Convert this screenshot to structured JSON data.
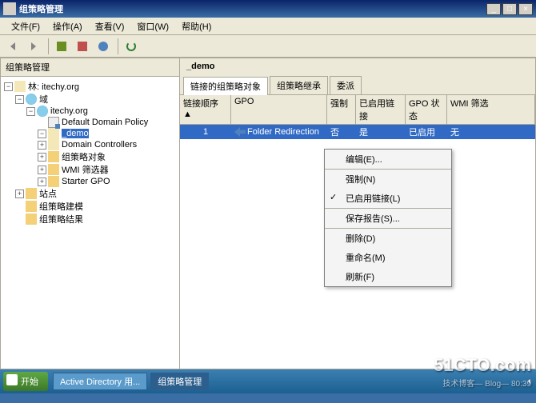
{
  "window": {
    "title": "组策略管理"
  },
  "menu": [
    "文件(F)",
    "操作(A)",
    "查看(V)",
    "窗口(W)",
    "帮助(H)"
  ],
  "tree": {
    "title": "组策略管理",
    "root": "林: itechy.org",
    "domain": "域",
    "site": "站点",
    "modeling": "组策略建模",
    "results": "组策略结果",
    "domainName": "itechy.org",
    "items": [
      "Default Domain Policy",
      "_demo",
      "Domain Controllers",
      "组策略对象",
      "WMI 筛选器",
      "Starter GPO"
    ]
  },
  "right": {
    "header": "_demo",
    "tabs": [
      "链接的组策略对象",
      "组策略继承",
      "委派"
    ],
    "cols": [
      "链接顺序 ▲",
      "GPO",
      "强制",
      "已启用链接",
      "GPO 状态",
      "WMI 筛选"
    ],
    "row": {
      "order": "1",
      "gpo": "Folder Redirection",
      "forced": "否",
      "linked": "是",
      "status": "已启用",
      "wmi": "无"
    }
  },
  "ctx": [
    "编辑(E)...",
    "强制(N)",
    "已启用链接(L)",
    "保存报告(S)...",
    "删除(D)",
    "重命名(M)",
    "刷新(F)"
  ],
  "taskbar": {
    "start": "开始",
    "app1": "Active Directory 用...",
    "app2": "组策略管理"
  },
  "watermark": "51CTO.com",
  "watermark2": "技术博客— Blog— 80:39"
}
